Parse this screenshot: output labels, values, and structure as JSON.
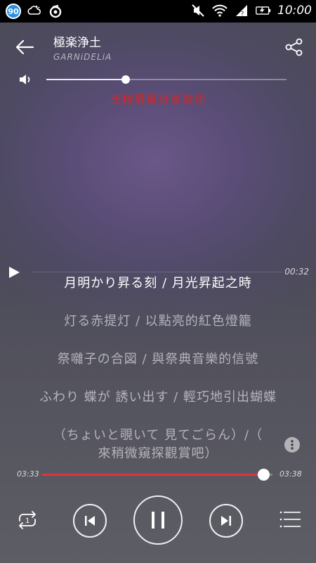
{
  "status_bar": {
    "badge_number": "90",
    "time": "10:00",
    "icons": [
      "weather-icon",
      "app-icon",
      "mute-icon",
      "wifi-icon",
      "signal-icon",
      "battery-charging-icon"
    ]
  },
  "header": {
    "title": "極楽浄土",
    "artist": "GARNiDELiA"
  },
  "volume": {
    "level": 0.33
  },
  "hint_text": "长按屏幕分享歌词",
  "mini_player": {
    "time": "00:32"
  },
  "lyrics": [
    "月明かり昇る刻 / 月光昇起之時",
    "灯る赤提灯 / 以點亮的紅色燈籠",
    "祭囃子の合図 / 與祭典音樂的信號",
    "ふわり 蝶が 誘い出す / 輕巧地引出蝴蝶",
    "（ちょいと覗いて 見てごらん）/（",
    "來稍微窺探觀賞吧）"
  ],
  "progress": {
    "current": "03:33",
    "total": "03:38",
    "fraction": 0.96
  },
  "controls": {
    "repeat_icon": "repeat-one-icon",
    "prev_icon": "skip-previous-icon",
    "play_icon": "pause-icon",
    "next_icon": "skip-next-icon",
    "list_icon": "playlist-icon"
  },
  "colors": {
    "accent": "#e0343e",
    "hint": "#d32626"
  }
}
